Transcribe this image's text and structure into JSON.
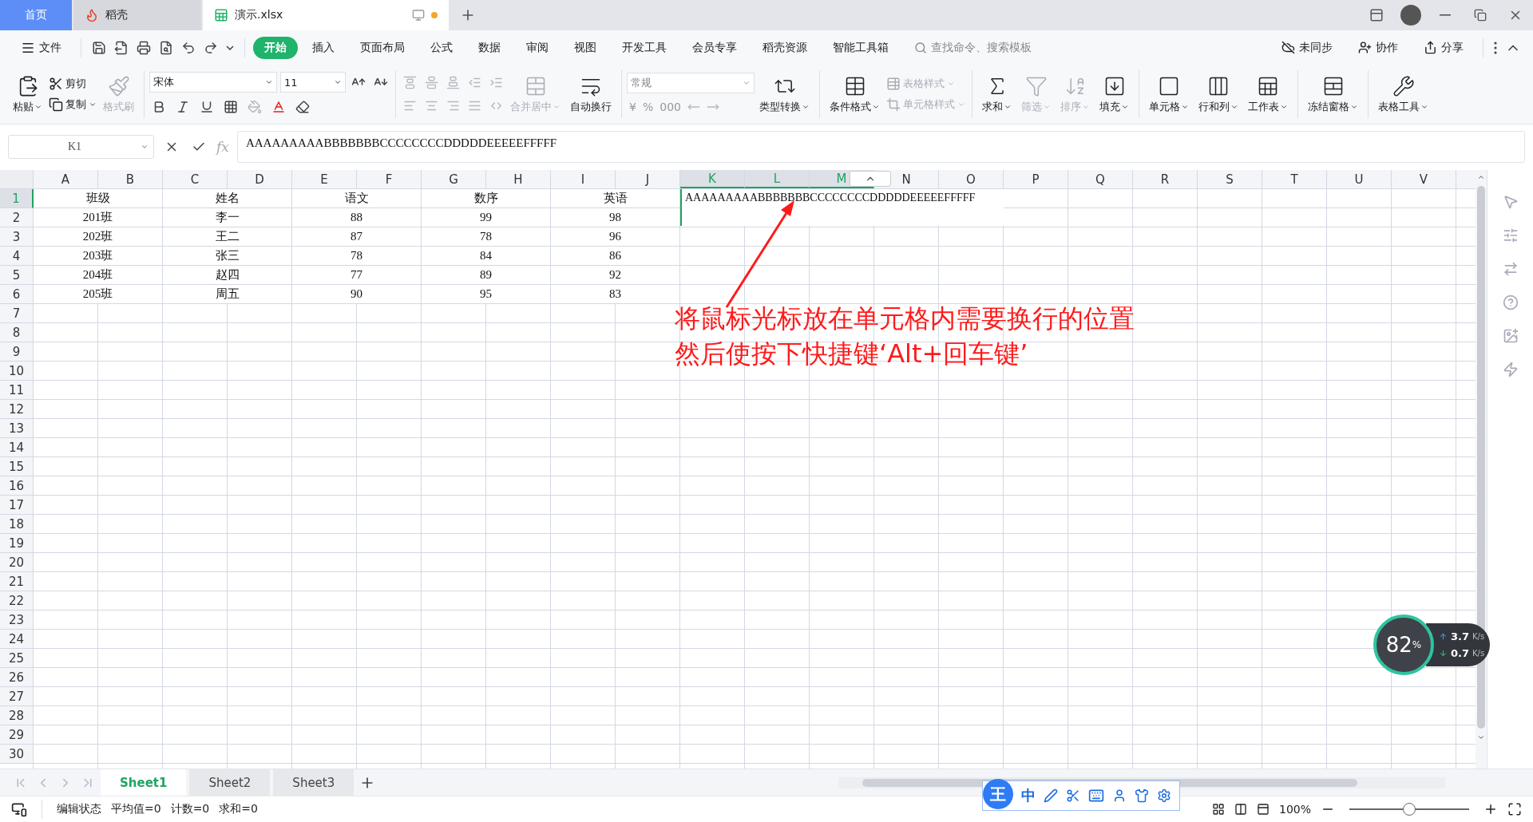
{
  "title_bar": {
    "tabs": [
      {
        "label": "首页",
        "kind": "home",
        "selected": false
      },
      {
        "label": "稻壳",
        "kind": "docer",
        "selected": false
      },
      {
        "label": "演示.xlsx",
        "kind": "sheet",
        "selected": true,
        "modified": true
      }
    ]
  },
  "menu": {
    "file": "文件",
    "tabs": [
      {
        "label": "开始",
        "selected": true
      },
      {
        "label": "插入",
        "selected": false
      },
      {
        "label": "页面布局",
        "selected": false
      },
      {
        "label": "公式",
        "selected": false
      },
      {
        "label": "数据",
        "selected": false
      },
      {
        "label": "审阅",
        "selected": false
      },
      {
        "label": "视图",
        "selected": false
      },
      {
        "label": "开发工具",
        "selected": false
      },
      {
        "label": "会员专享",
        "selected": false
      },
      {
        "label": "稻壳资源",
        "selected": false
      },
      {
        "label": "智能工具箱",
        "selected": false
      }
    ],
    "search": {
      "placeholder": "查找命令、搜索模板"
    },
    "actions": [
      "未同步",
      "协作",
      "分享"
    ]
  },
  "ribbon": {
    "paste": "粘贴",
    "cut": "剪切",
    "copy": "复制",
    "format_painter": {
      "label": "格式刷",
      "disabled": true
    },
    "font": "宋体",
    "size": "11",
    "merge": {
      "label": "合并居中",
      "disabled": true
    },
    "wrap": {
      "label": "自动换行",
      "disabled": false
    },
    "number_format": "常规",
    "currency": "¥",
    "percent": "%",
    "thousands": "000",
    "convert": "类型转换",
    "conditional": {
      "label": "条件格式",
      "disabled": false
    },
    "styles": [
      {
        "label": "表格样式",
        "disabled": true
      },
      {
        "label": "单元格样式",
        "disabled": true
      }
    ],
    "tools": [
      {
        "label": "求和",
        "disabled": false
      },
      {
        "label": "筛选",
        "disabled": true
      },
      {
        "label": "排序",
        "disabled": true
      },
      {
        "label": "填充",
        "disabled": false
      },
      {
        "label": "单元格",
        "disabled": false
      },
      {
        "label": "行和列",
        "disabled": false
      },
      {
        "label": "工作表",
        "disabled": false
      },
      {
        "label": "冻结窗格",
        "disabled": false
      },
      {
        "label": "表格工具",
        "disabled": false
      }
    ]
  },
  "formula_bar": {
    "name_box": "K1",
    "fx": "fx",
    "formula": "AAAAAAAAABBBBBBBCCCCCCCCDDDDDEEEEEFFFFF"
  },
  "sheet": {
    "columns": [
      {
        "label": "A",
        "selected": false
      },
      {
        "label": "B",
        "selected": false
      },
      {
        "label": "C",
        "selected": false
      },
      {
        "label": "D",
        "selected": false
      },
      {
        "label": "E",
        "selected": false
      },
      {
        "label": "F",
        "selected": false
      },
      {
        "label": "G",
        "selected": false
      },
      {
        "label": "H",
        "selected": false
      },
      {
        "label": "I",
        "selected": false
      },
      {
        "label": "J",
        "selected": false
      },
      {
        "label": "K",
        "selected": true
      },
      {
        "label": "L",
        "selected": true
      },
      {
        "label": "M",
        "selected": true
      },
      {
        "label": "N",
        "selected": false
      },
      {
        "label": "O",
        "selected": false
      },
      {
        "label": "P",
        "selected": false
      },
      {
        "label": "Q",
        "selected": false
      },
      {
        "label": "R",
        "selected": false
      },
      {
        "label": "S",
        "selected": false
      },
      {
        "label": "T",
        "selected": false
      },
      {
        "label": "U",
        "selected": false
      },
      {
        "label": "V",
        "selected": false
      }
    ],
    "rows": [
      {
        "label": "1",
        "selected": true
      },
      {
        "label": "2",
        "selected": false
      },
      {
        "label": "3",
        "selected": false
      },
      {
        "label": "4",
        "selected": false
      },
      {
        "label": "5",
        "selected": false
      },
      {
        "label": "6",
        "selected": false
      },
      {
        "label": "7",
        "selected": false
      },
      {
        "label": "8",
        "selected": false
      },
      {
        "label": "9",
        "selected": false
      },
      {
        "label": "10",
        "selected": false
      },
      {
        "label": "11",
        "selected": false
      },
      {
        "label": "12",
        "selected": false
      },
      {
        "label": "13",
        "selected": false
      },
      {
        "label": "14",
        "selected": false
      },
      {
        "label": "15",
        "selected": false
      },
      {
        "label": "16",
        "selected": false
      },
      {
        "label": "17",
        "selected": false
      },
      {
        "label": "18",
        "selected": false
      },
      {
        "label": "19",
        "selected": false
      },
      {
        "label": "20",
        "selected": false
      },
      {
        "label": "21",
        "selected": false
      },
      {
        "label": "22",
        "selected": false
      },
      {
        "label": "23",
        "selected": false
      },
      {
        "label": "24",
        "selected": false
      },
      {
        "label": "25",
        "selected": false
      },
      {
        "label": "26",
        "selected": false
      },
      {
        "label": "27",
        "selected": false
      },
      {
        "label": "28",
        "selected": false
      },
      {
        "label": "29",
        "selected": false
      },
      {
        "label": "30",
        "selected": false
      }
    ],
    "cells": [
      [
        "班级",
        "姓名",
        "语文",
        "数序",
        "英语"
      ],
      [
        "201班",
        "李一",
        "88",
        "99",
        "98"
      ],
      [
        "202班",
        "王二",
        "87",
        "78",
        "96"
      ],
      [
        "203班",
        "张三",
        "78",
        "84",
        "86"
      ],
      [
        "204班",
        "赵四",
        "77",
        "89",
        "92"
      ],
      [
        "205班",
        "周五",
        "90",
        "95",
        "83"
      ]
    ],
    "editor": "AAAAAAAAABBBBBBBCCCCCCCCDDDDDEEEEEFFFFF"
  },
  "annotation": {
    "lines": [
      "将鼠标光标放在单元格内需要换行的位置",
      "然后使按下快捷键‘Alt+回车键’"
    ]
  },
  "sheet_tabs": [
    {
      "label": "Sheet1",
      "selected": true
    },
    {
      "label": "Sheet2",
      "selected": false
    },
    {
      "label": "Sheet3",
      "selected": false
    }
  ],
  "status_bar": {
    "mode": "编辑状态",
    "stats": [
      "平均值=0",
      "计数=0",
      "求和=0"
    ],
    "zoom": "100%",
    "zoom_slider": {
      "level": 0.5
    }
  },
  "net_widget": {
    "value": "82",
    "unit": "%",
    "up": {
      "value": "3.7",
      "unit": "K/s"
    },
    "down": {
      "value": "0.7",
      "unit": "K/s"
    }
  },
  "ime": {
    "logo": "王",
    "mode": "中"
  }
}
